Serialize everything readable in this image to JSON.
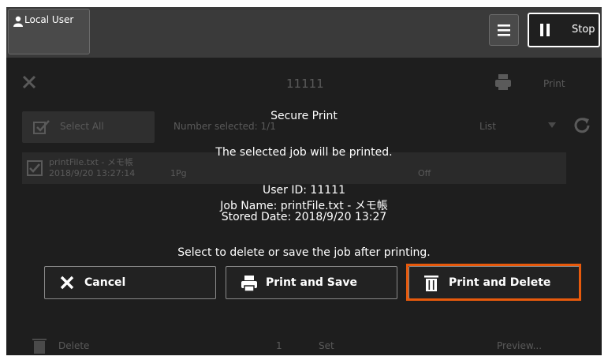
{
  "topbar": {
    "user_label": "Local User",
    "stop_label": "Stop"
  },
  "background": {
    "job_title": "11111",
    "print_label": "Print",
    "select_all_label": "Select All",
    "number_selected_label": "Number selected: 1/1",
    "list_label": "List",
    "job_name": "printFile.txt - メモ帳",
    "job_date": "2018/9/20 13:27:14",
    "pages": "1Pg",
    "off_label": "Off",
    "delete_label": "Delete",
    "page_num": "1",
    "set_label": "Set",
    "preview_label": "Preview..."
  },
  "dialog": {
    "title": "Secure Print",
    "message": "The selected job will be printed.",
    "user_id": "User ID: 11111",
    "job_name": "Job Name: printFile.txt - メモ帳",
    "stored_date": "Stored Date: 2018/9/20 13:27",
    "instruction": "Select to delete or save the job after printing.",
    "cancel_label": "Cancel",
    "print_save_label": "Print and Save",
    "print_delete_label": "Print and Delete"
  },
  "colors": {
    "highlight": "#e85a0c",
    "background": "#1e1e1e",
    "topbar": "#3a3a3a"
  }
}
